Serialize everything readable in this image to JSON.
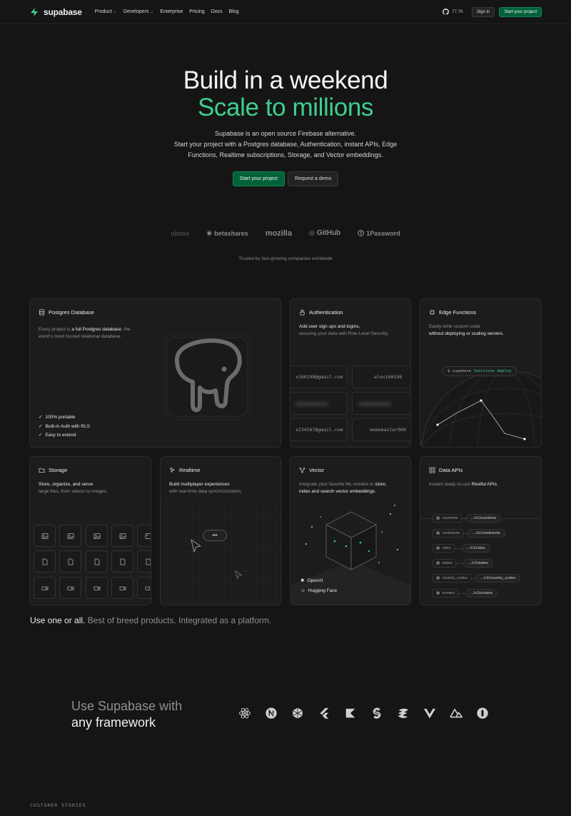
{
  "nav": {
    "brand": "supabase",
    "links": [
      {
        "label": "Product",
        "dropdown": true
      },
      {
        "label": "Developers",
        "dropdown": true
      },
      {
        "label": "Enterprise",
        "dropdown": false
      },
      {
        "label": "Pricing",
        "dropdown": false
      },
      {
        "label": "Docs",
        "dropdown": false
      },
      {
        "label": "Blog",
        "dropdown": false
      }
    ],
    "github_stars": "77.7K",
    "sign_in": "Sign in",
    "start_project": "Start your project"
  },
  "hero": {
    "line1": "Build in a weekend",
    "line2": "Scale to millions",
    "sub1": "Supabase is an open source Firebase alternative.",
    "sub2": "Start your project with a Postgres database, Authentication, instant APIs, Edge",
    "sub3": "Functions, Realtime subscriptions, Storage, and Vector embeddings.",
    "cta_primary": "Start your project",
    "cta_secondary": "Request a demo"
  },
  "customers": {
    "logos": [
      "ubase",
      "betashares",
      "mozilla",
      "GitHub",
      "1Password"
    ],
    "caption": "Trusted by fast-growing companies worldwide"
  },
  "cards": {
    "postgres": {
      "title": "Postgres Database",
      "desc_a": "Every project is ",
      "desc_b": "a full Postgres",
      "desc_c": "database",
      "desc_d": ", the world's most trusted",
      "desc_e": "relational database.",
      "features": [
        "100% portable",
        "Built-in Auth with RLS",
        "Easy to extend"
      ]
    },
    "auth": {
      "title": "Authentication",
      "desc1": "Add user sign ups and logins,",
      "desc2": "securing your data with Row Level Security.",
      "cells": [
        "x160198@gmail.com",
        "alex160198",
        "x234567@gmail.com",
        "mememaster000"
      ]
    },
    "edge": {
      "title": "Edge Functions",
      "desc1": "Easily write custom code",
      "desc2": "without deploying or scaling servers.",
      "cmd_prefix": "$ supabase",
      "cmd": "functions deploy"
    },
    "storage": {
      "title": "Storage",
      "desc1": "Store, organize, and serve",
      "desc2": "large files, from videos to images."
    },
    "realtime": {
      "title": "Realtime",
      "desc1": "Build multiplayer experiences",
      "desc2": "with real-time data synchronization.",
      "bubble": "•••"
    },
    "vector": {
      "title": "Vector",
      "desc1": "Integrate your favorite ML-models to ",
      "desc1b": "store,",
      "desc2": "index and search vector embeddings",
      "desc2b": ".",
      "providers": [
        "OpenAI",
        "Hugging Face"
      ]
    },
    "apis": {
      "title": "Data APIs",
      "desc_a": "Instant ready-to-use ",
      "desc_b": "Restful APIs",
      "desc_c": ".",
      "rows": [
        {
          "table": "countries",
          "endpoint": ".../v1/countries"
        },
        {
          "table": "continents",
          "endpoint": ".../v1/continents"
        },
        {
          "table": "cities",
          "endpoint": ".../v1/cities"
        },
        {
          "table": "states",
          "endpoint": ".../v1/states"
        },
        {
          "table": "country_codes",
          "endpoint": ".../v1/country_codes"
        },
        {
          "table": "oceans",
          "endpoint": ".../v1/oceans"
        }
      ]
    }
  },
  "platform": {
    "strong": "Use one or all.",
    "muted": " Best of breed products. Integrated as a platform."
  },
  "frameworks": {
    "title_a": "Use Supabase with",
    "title_b": "any framework",
    "icons": [
      "react-icon",
      "nextjs-icon",
      "redwood-icon",
      "flutter-icon",
      "kotlin-icon",
      "svelte-icon",
      "solidjs-icon",
      "vue-icon",
      "nuxt-icon",
      "refine-icon"
    ]
  },
  "stories": {
    "label": "CUSTOMER STORIES"
  },
  "colors": {
    "accent": "#3ecf8e",
    "bg": "#151515",
    "card": "#1c1c1c",
    "btn_green": "#006239"
  }
}
